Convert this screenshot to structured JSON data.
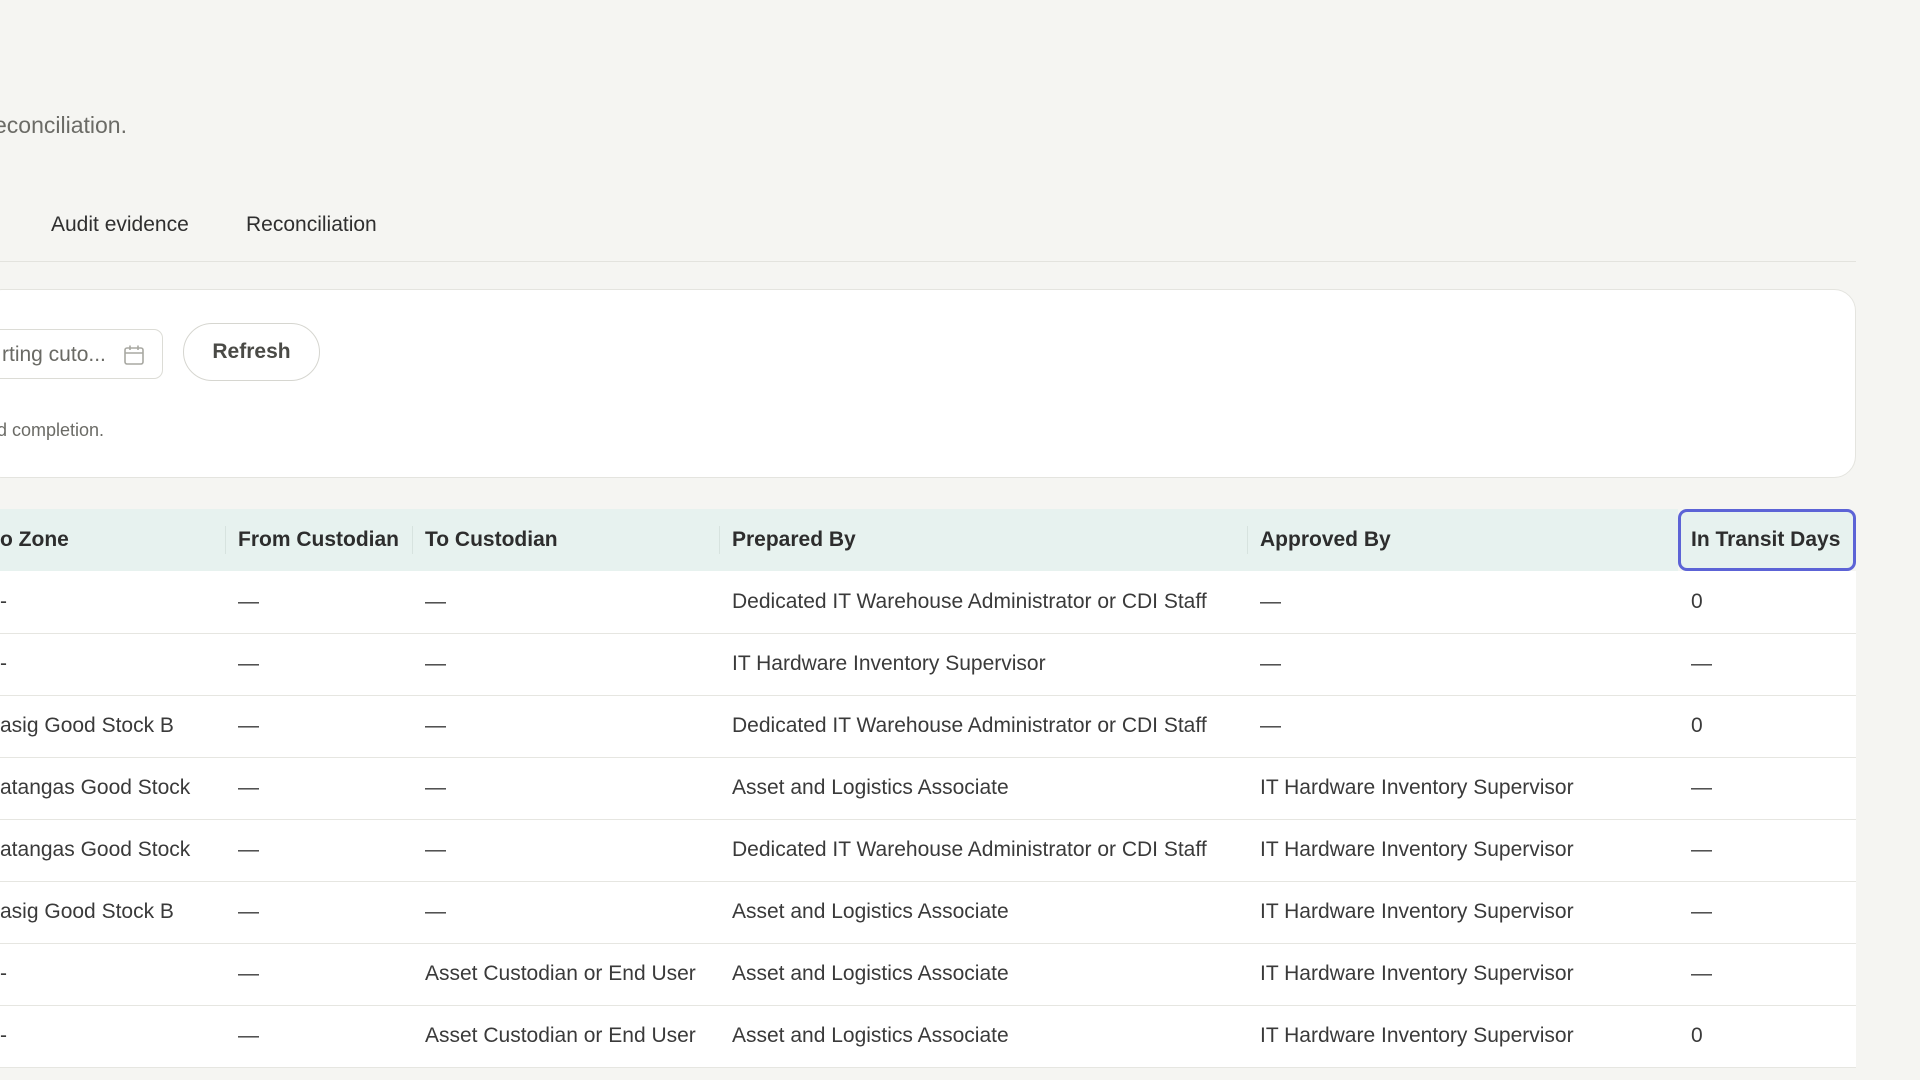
{
  "header": {
    "subtitle": "econciliation."
  },
  "tabs": [
    {
      "label": "Audit evidence"
    },
    {
      "label": "Reconciliation"
    }
  ],
  "filters": {
    "date_placeholder": "rting cuto...",
    "refresh_label": "Refresh",
    "note": "d completion."
  },
  "table": {
    "columns": [
      "o Zone",
      "From Custodian",
      "To Custodian",
      "Prepared By",
      "Approved By",
      "In Transit Days"
    ],
    "focused_column": "In Transit Days",
    "rows": [
      [
        "-",
        "—",
        "—",
        "Dedicated IT Warehouse Administrator or CDI Staff",
        "—",
        "0"
      ],
      [
        "-",
        "—",
        "—",
        "IT Hardware Inventory Supervisor",
        "—",
        "—"
      ],
      [
        "asig Good Stock B",
        "—",
        "—",
        "Dedicated IT Warehouse Administrator or CDI Staff",
        "—",
        "0"
      ],
      [
        "atangas Good Stock",
        "—",
        "—",
        "Asset and Logistics Associate",
        "IT Hardware Inventory Supervisor",
        "—"
      ],
      [
        "atangas Good Stock",
        "—",
        "—",
        "Dedicated IT Warehouse Administrator or CDI Staff",
        "IT Hardware Inventory Supervisor",
        "—"
      ],
      [
        "asig Good Stock B",
        "—",
        "—",
        "Asset and Logistics Associate",
        "IT Hardware Inventory Supervisor",
        "—"
      ],
      [
        "-",
        "—",
        "Asset Custodian or End User",
        "Asset and Logistics Associate",
        "IT Hardware Inventory Supervisor",
        "—"
      ],
      [
        "-",
        "—",
        "Asset Custodian or End User",
        "Asset and Logistics Associate",
        "IT Hardware Inventory Supervisor",
        "0"
      ]
    ]
  },
  "icons": {
    "calendar": "calendar-icon"
  },
  "colors": {
    "background": "#f5f5f2",
    "header_row": "#e7f2ef",
    "focus_ring": "#5c63d6"
  }
}
